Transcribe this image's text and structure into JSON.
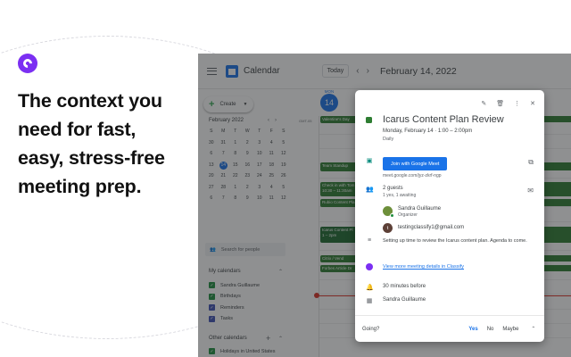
{
  "promo": {
    "headline_lines": [
      "The context you",
      "need for fast,",
      "easy, stress-free",
      "meeting prep."
    ]
  },
  "calendar": {
    "app_name": "Calendar",
    "today_label": "Today",
    "current_date": "February 14, 2022",
    "create_label": "Create",
    "mini_month": "February 2022",
    "mini_days": [
      "S",
      "M",
      "T",
      "W",
      "T",
      "F",
      "S",
      "30",
      "31",
      "1",
      "2",
      "3",
      "4",
      "5",
      "6",
      "7",
      "8",
      "9",
      "10",
      "11",
      "12",
      "13",
      "14",
      "15",
      "16",
      "17",
      "18",
      "19",
      "20",
      "21",
      "22",
      "23",
      "24",
      "25",
      "26",
      "27",
      "28",
      "1",
      "2",
      "3",
      "4",
      "5",
      "6",
      "7",
      "8",
      "9",
      "10",
      "11",
      "12"
    ],
    "search_people_placeholder": "Search for people",
    "my_calendars_label": "My calendars",
    "my_calendars": [
      {
        "name": "Sandra Guillaume",
        "color": "#1e8e3e"
      },
      {
        "name": "Birthdays",
        "color": "#1e8e3e"
      },
      {
        "name": "Reminders",
        "color": "#3f51b5"
      },
      {
        "name": "Tasks",
        "color": "#3f51b5"
      }
    ],
    "other_calendars_label": "Other calendars",
    "other_calendars": [
      {
        "name": "Holidays in United States",
        "color": "#1e8e3e"
      }
    ],
    "day_name": "MON",
    "day_number": "14",
    "timezone": "GMT-05",
    "events": [
      {
        "label": "Valentine's Day"
      },
      {
        "label": "Team Standup"
      },
      {
        "label": "Check in with Tom\n10:30 – 11:30am"
      },
      {
        "label": "Rubio Content Pla"
      },
      {
        "label": "Icarus Content Pl\n1 – 2pm"
      },
      {
        "label": "Citrix / Vend"
      },
      {
        "label": "Forbes Article Dr"
      }
    ]
  },
  "popup": {
    "title": "Icarus Content Plan Review",
    "when": "Monday, February 14  ·  1:00 – 2:00pm",
    "recurrence": "Daily",
    "meet_button": "Join with Google Meet",
    "meet_url": "meet.google.com/jyz-zkrf-ngp",
    "guests_count": "2 guests",
    "guests_status": "1 yes, 1 awaiting",
    "guests": [
      {
        "name": "Sandra Guillaume",
        "role": "Organizer",
        "initial": "",
        "color": "#6d8f3a"
      },
      {
        "name": "testingclassify1@gmail.com",
        "role": "",
        "initial": "t",
        "color": "#5d4037"
      }
    ],
    "description": "Setting up time to review the Icarus content plan. Agenda to come.",
    "classify_link": "View more meeting details in Classify",
    "reminder": "30 minutes before",
    "owner": "Sandra Guillaume",
    "going_label": "Going?",
    "rsvp_yes": "Yes",
    "rsvp_no": "No",
    "rsvp_maybe": "Maybe"
  }
}
